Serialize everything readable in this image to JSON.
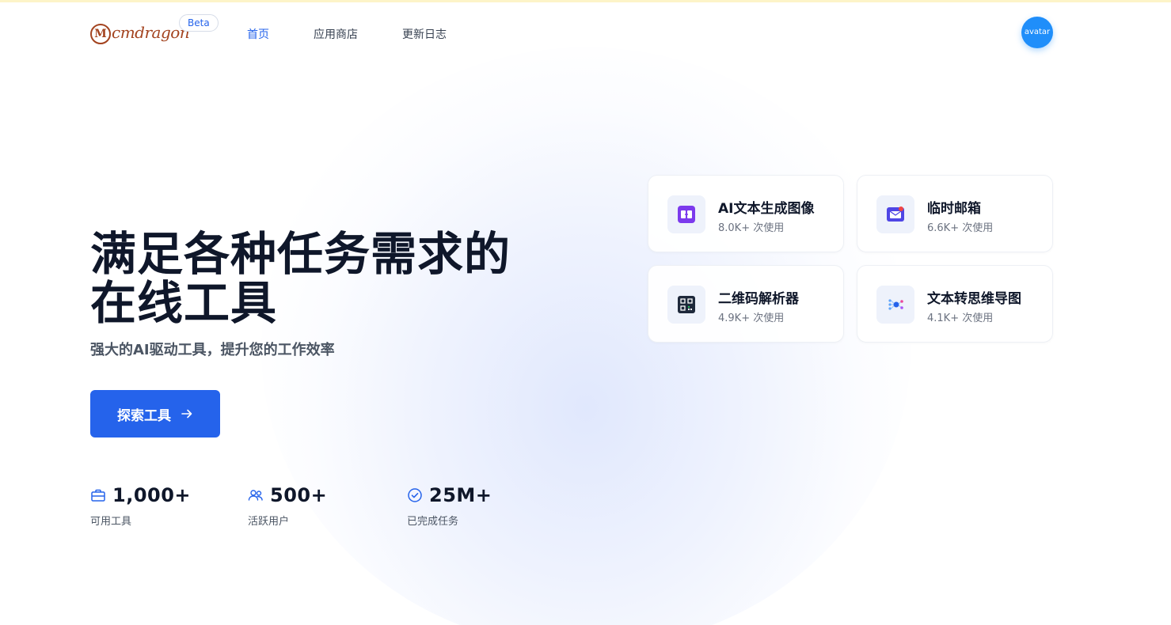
{
  "header": {
    "logo_text": "cmdragon",
    "logo_mark": "M",
    "beta": "Beta",
    "nav": [
      "首页",
      "应用商店",
      "更新日志"
    ],
    "avatar": "avatar",
    "colors": {
      "brand": "#a3431f",
      "accent": "#2563eb",
      "avatar_bg": "#1f8efa"
    }
  },
  "hero": {
    "title_line1": "满足各种任务需求的",
    "title_line2": "在线工具",
    "subtitle": "强大的AI驱动工具，提升您的工作效率",
    "cta_label": "探索工具",
    "cta_icon": "arrow-right-icon"
  },
  "stats": [
    {
      "icon": "toolbox-icon",
      "value": "1,000+",
      "label": "可用工具"
    },
    {
      "icon": "users-icon",
      "value": "500+",
      "label": "活跃用户"
    },
    {
      "icon": "check-circle-icon",
      "value": "25M+",
      "label": "已完成任务"
    }
  ],
  "tools": [
    {
      "icon": "image-generation-icon",
      "title": "AI文本生成图像",
      "usage": "8.0K+ 次使用"
    },
    {
      "icon": "mailbox-icon",
      "title": "临时邮箱",
      "usage": "6.6K+ 次使用"
    },
    {
      "icon": "qrcode-icon",
      "title": "二维码解析器",
      "usage": "4.9K+ 次使用"
    },
    {
      "icon": "mindmap-icon",
      "title": "文本转思维导图",
      "usage": "4.1K+ 次使用"
    }
  ]
}
